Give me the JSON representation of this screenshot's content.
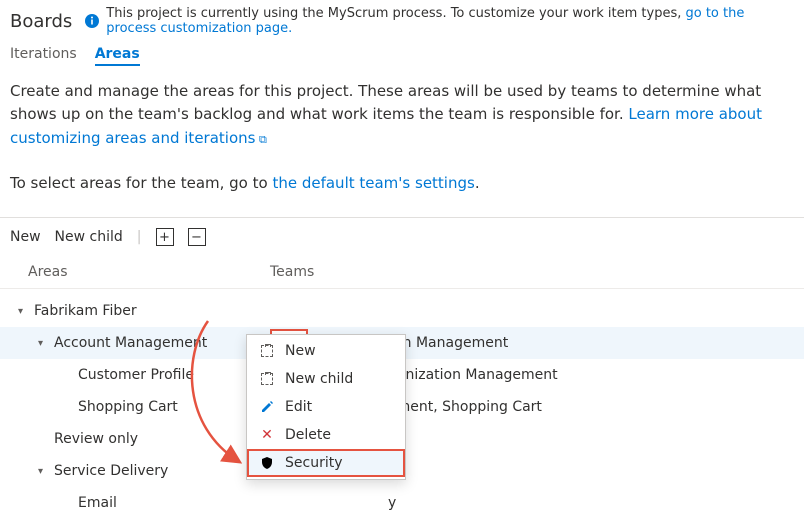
{
  "header": {
    "title": "Boards",
    "info_text_prefix": "This project is currently using the MyScrum process. To customize your work item types, ",
    "info_link": "go to the process customization page."
  },
  "tabs": {
    "iterations": "Iterations",
    "areas": "Areas"
  },
  "intro": {
    "line1_prefix": "Create and manage the areas for this project. These areas will be used by teams to determine what shows up on the team's backlog and what work items the team is responsible for. ",
    "learn_more": "Learn more about customizing areas and iterations",
    "line2_prefix": "To select areas for the team, go to ",
    "team_settings_link": "the default team's settings",
    "period": "."
  },
  "toolbar": {
    "new": "New",
    "new_child": "New child",
    "expand": "+",
    "collapse": "−"
  },
  "columns": {
    "areas": "Areas",
    "teams": "Teams"
  },
  "tree": {
    "items": [
      {
        "label": "Fabrikam Fiber",
        "indent": 0,
        "expandable": true
      },
      {
        "label": "Account Management",
        "indent": 1,
        "expandable": true,
        "selected": true,
        "teams": "Organization Management"
      },
      {
        "label": "Customer Profile",
        "indent": 2,
        "expandable": false,
        "teams": "ganization Management"
      },
      {
        "label": "Shopping Cart",
        "indent": 2,
        "expandable": false,
        "teams": "ement, Shopping Cart"
      },
      {
        "label": "Review only",
        "indent": 1,
        "expandable": false
      },
      {
        "label": "Service Delivery",
        "indent": 1,
        "expandable": true
      },
      {
        "label": "Email",
        "indent": 2,
        "expandable": false,
        "teams": "y"
      }
    ]
  },
  "context_menu": {
    "new": "New",
    "new_child": "New child",
    "edit": "Edit",
    "delete": "Delete",
    "security": "Security"
  }
}
